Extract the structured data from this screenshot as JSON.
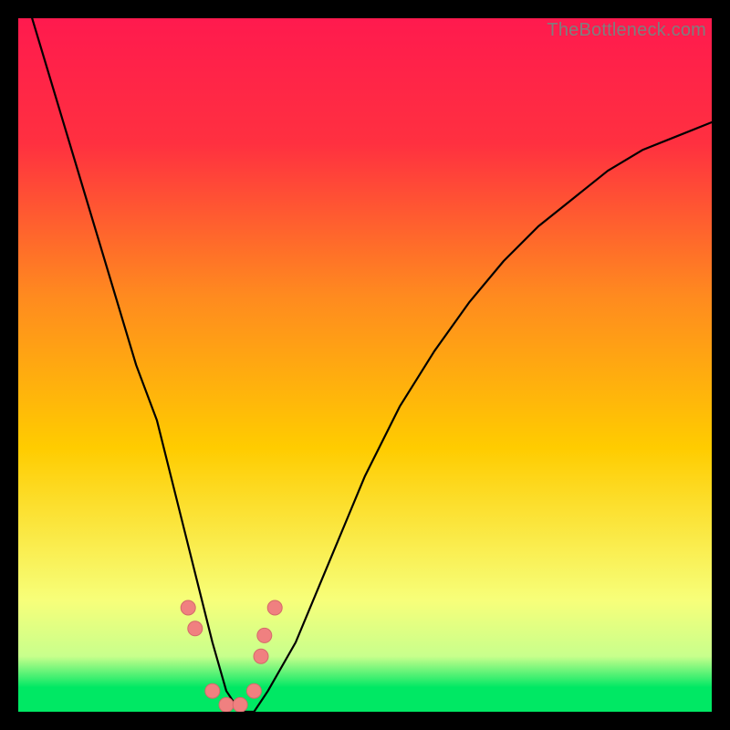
{
  "watermark": "TheBottleneck.com",
  "colors": {
    "gradient_top": "#ff1a4e",
    "gradient_mid": "#ffcc00",
    "gradient_low_yellow": "#f7ff7a",
    "gradient_green": "#00e864",
    "curve": "#000000",
    "point_fill": "#f08080",
    "point_stroke": "#d46a6a",
    "background": "#000000",
    "watermark": "#7e7e7e"
  },
  "chart_data": {
    "type": "line",
    "title": "",
    "xlabel": "",
    "ylabel": "",
    "xlim": [
      0,
      100
    ],
    "ylim": [
      0,
      100
    ],
    "grid": false,
    "legend": false,
    "notes": "V-shaped bottleneck curve over a red→yellow→green vertical gradient. Y increases upward; minimum of curve sits near bottom (green band). Values are estimated from pixel positions because the chart has no axis ticks.",
    "series": [
      {
        "name": "bottleneck-curve",
        "x": [
          2,
          5,
          8,
          11,
          14,
          17,
          20,
          22,
          24,
          26,
          28,
          30,
          32,
          34,
          36,
          40,
          45,
          50,
          55,
          60,
          65,
          70,
          75,
          80,
          85,
          90,
          95,
          100
        ],
        "y": [
          100,
          90,
          80,
          70,
          60,
          50,
          42,
          34,
          26,
          18,
          10,
          3,
          0,
          0,
          3,
          10,
          22,
          34,
          44,
          52,
          59,
          65,
          70,
          74,
          78,
          81,
          83,
          85
        ]
      }
    ],
    "points": [
      {
        "x": 24.5,
        "y": 15
      },
      {
        "x": 25.5,
        "y": 12
      },
      {
        "x": 28.0,
        "y": 3
      },
      {
        "x": 30.0,
        "y": 1
      },
      {
        "x": 32.0,
        "y": 1
      },
      {
        "x": 34.0,
        "y": 3
      },
      {
        "x": 35.0,
        "y": 8
      },
      {
        "x": 35.5,
        "y": 11
      },
      {
        "x": 37.0,
        "y": 15
      }
    ],
    "gradient_stops": [
      {
        "pos": 0.0,
        "color": "#ff1a4e"
      },
      {
        "pos": 0.18,
        "color": "#ff3040"
      },
      {
        "pos": 0.4,
        "color": "#ff8a1f"
      },
      {
        "pos": 0.62,
        "color": "#ffcc00"
      },
      {
        "pos": 0.84,
        "color": "#f7ff7a"
      },
      {
        "pos": 0.92,
        "color": "#c8ff8c"
      },
      {
        "pos": 0.965,
        "color": "#00e864"
      },
      {
        "pos": 1.0,
        "color": "#00e864"
      }
    ]
  }
}
